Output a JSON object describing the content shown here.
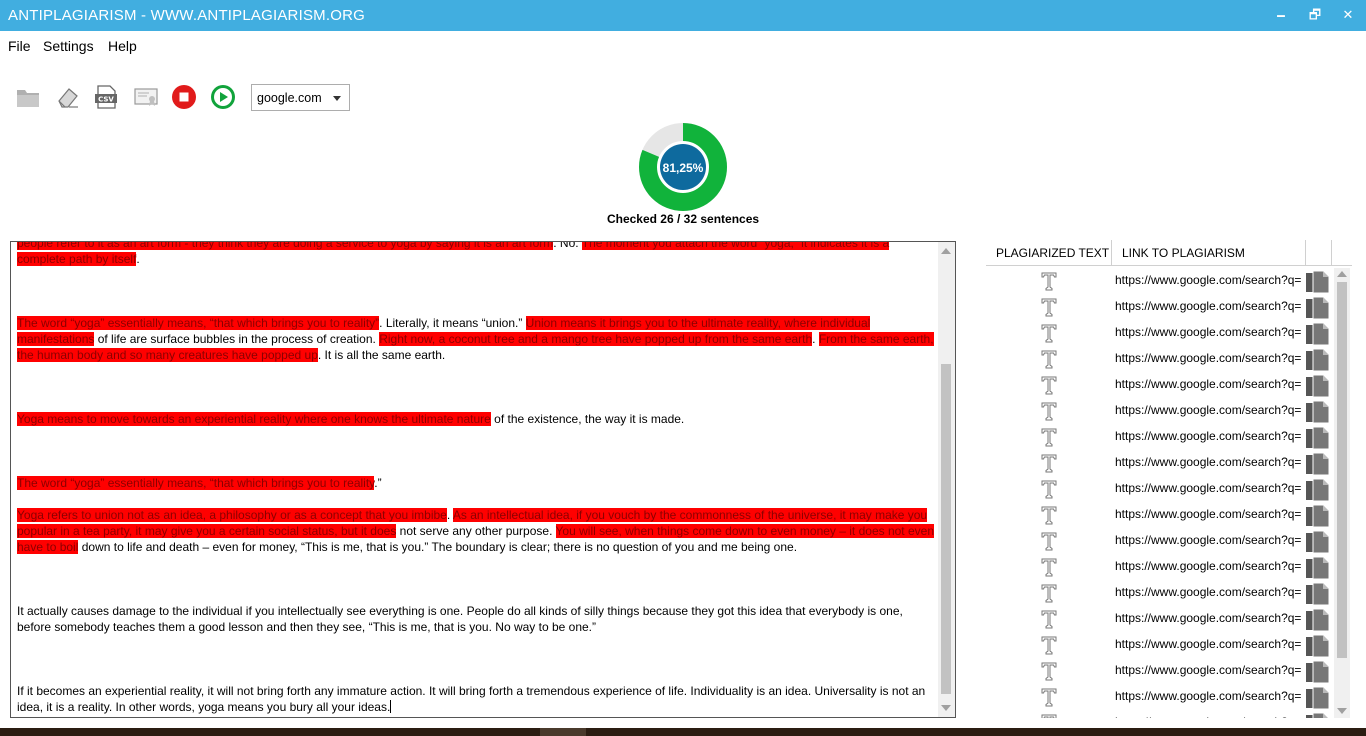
{
  "window": {
    "title": "ANTIPLAGIARISM - WWW.ANTIPLAGIARISM.ORG",
    "minimize": "🗕",
    "maximize": "🗗",
    "close": "✕"
  },
  "menu": {
    "file": "File",
    "settings": "Settings",
    "help": "Help"
  },
  "toolbar": {
    "search_engine": "google.com",
    "icons": [
      "folder-icon",
      "eraser-icon",
      "csv-icon",
      "certificate-icon",
      "stop-icon",
      "play-icon"
    ],
    "colors": {
      "stop": "#e11b1b",
      "play": "#11a33b"
    }
  },
  "progress": {
    "percent_label": "81,25%",
    "value": 0.8125,
    "status": "Checked 26 / 32 sentences",
    "colors": {
      "ring": "#11b33b",
      "center": "#0e6a9e"
    }
  },
  "editor": {
    "colors": {
      "highlight": "#ff0000"
    },
    "p1": {
      "a": "people refer to it as an art form - they think they are doing a service to yoga by saying it is an art form",
      "b": ". No. ",
      "c": "The moment you attach the word “yoga,” it indicates it is a complete path by itself",
      "d": "."
    },
    "p2": {
      "a": "The word “yoga” essentially means, “that which brings you to reality”",
      "b": ". Literally, it means “union.” ",
      "c": "Union means it brings you to the ultimate reality, where individual manifestations",
      "d": " of life are surface bubbles in the process of creation. ",
      "e": "Right now, a coconut tree and a mango tree have popped up from the same earth",
      "f": ". ",
      "g": "From the same earth, the human body and so many creatures have popped up",
      "h": ". It is all the same earth."
    },
    "p3": {
      "a": "Yoga means to move towards an experiential reality where one knows the ultimate nature",
      "b": " of the existence, the way it is made."
    },
    "p4": {
      "a": "The word “yoga” essentially means, “that which brings you to reality",
      "b": ".”"
    },
    "p5": {
      "a": "Yoga refers to union not as an idea, a philosophy or as a concept that you imbibe",
      "b": ". ",
      "c": "As an intellectual idea, if you vouch by the commonness of the universe, it may make you popular in a tea party, it may give you a certain social status, but it does",
      "d": " not serve any other purpose. ",
      "e": "You will see, when things come down to even money – it does not even have to boil",
      "f": " down to life and death – even for money, “This is me, that is you.” The boundary is clear; there is no question of you and me being one."
    },
    "p6": "It actually causes damage to the individual if you intellectually see everything is one. People do all kinds of silly things because they got this idea that everybody is one, before somebody teaches them a good lesson and then they see, “This is me, that is you. No way to be one.”",
    "p7": "If it becomes an experiential reality, it will not bring forth any immature action. It will bring forth a tremendous experience of life. Individuality is an idea. Universality is not an idea, it is a reality. In other words, yoga means you bury all your ideas."
  },
  "results": {
    "header_text": "PLAGIARIZED TEXT",
    "header_link": "LINK TO PLAGIARISM",
    "rows": [
      "https://www.google.com/search?q=",
      "https://www.google.com/search?q=",
      "https://www.google.com/search?q=",
      "https://www.google.com/search?q=",
      "https://www.google.com/search?q=",
      "https://www.google.com/search?q=",
      "https://www.google.com/search?q=",
      "https://www.google.com/search?q=",
      "https://www.google.com/search?q=",
      "https://www.google.com/search?q=",
      "https://www.google.com/search?q=",
      "https://www.google.com/search?q=",
      "https://www.google.com/search?q=",
      "https://www.google.com/search?q=",
      "https://www.google.com/search?q=",
      "https://www.google.com/search?q=",
      "https://www.google.com/search?q=",
      "https://www.google.com/search?q="
    ]
  }
}
